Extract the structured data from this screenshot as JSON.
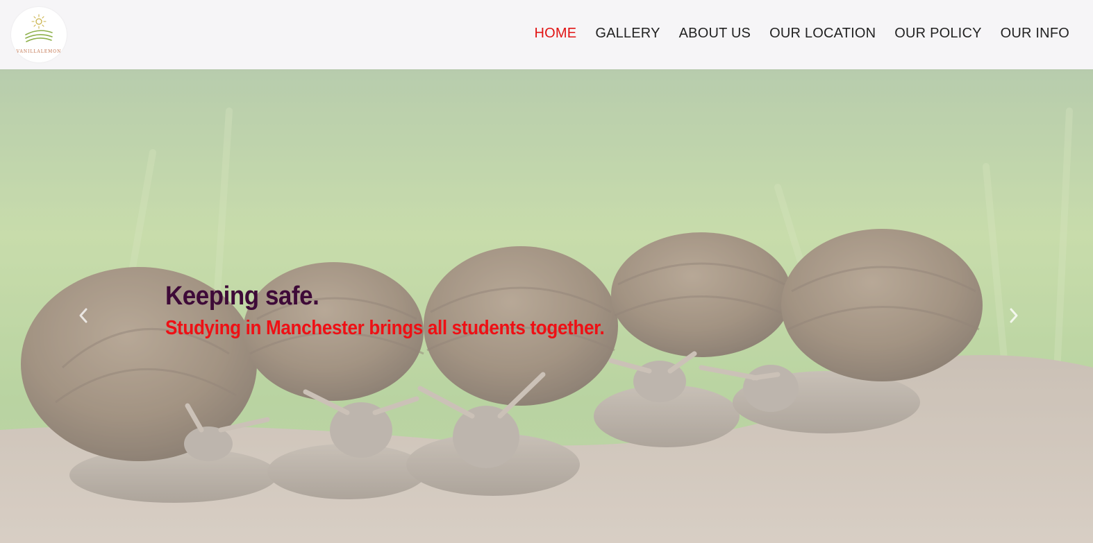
{
  "brand": {
    "logo_text": "VANILLALEMON",
    "logo_icon": "sun-fields-logo-icon"
  },
  "nav": {
    "items": [
      {
        "label": "HOME",
        "active": true
      },
      {
        "label": "GALLERY",
        "active": false
      },
      {
        "label": "ABOUT US",
        "active": false
      },
      {
        "label": "OUR LOCATION",
        "active": false
      },
      {
        "label": "OUR POLICY",
        "active": false
      },
      {
        "label": "OUR INFO",
        "active": false
      }
    ]
  },
  "hero": {
    "title": "Keeping safe.",
    "subtitle": "Studying in Manchester brings all students together.",
    "prev_icon": "chevron-left-icon",
    "next_icon": "chevron-right-icon"
  },
  "colors": {
    "active_nav": "#e11414",
    "nav_text": "#222222",
    "title": "#3e0a38",
    "subtitle": "#ee1015",
    "header_bg": "#f6f5f7"
  }
}
